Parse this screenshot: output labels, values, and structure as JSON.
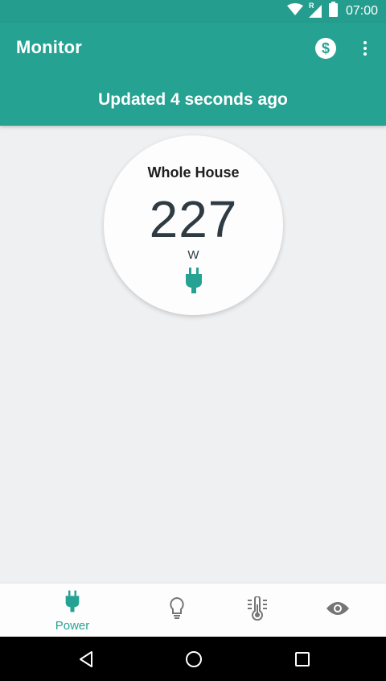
{
  "status_bar": {
    "time": "07:00",
    "roaming_indicator": "R",
    "icons": [
      "wifi-icon",
      "signal-icon",
      "battery-icon"
    ]
  },
  "app_bar": {
    "title": "Monitor",
    "updated_text": "Updated 4 seconds ago",
    "actions": {
      "currency_symbol": "$",
      "currency_icon": "dollar-icon",
      "overflow_icon": "more-vert-icon"
    }
  },
  "monitor_card": {
    "title": "Whole House",
    "value": "227",
    "unit": "W",
    "icon": "plug-icon"
  },
  "bottom_nav": {
    "items": [
      {
        "label": "Power",
        "icon": "plug-icon",
        "active": true
      },
      {
        "label": "",
        "icon": "lightbulb-icon",
        "active": false
      },
      {
        "label": "",
        "icon": "thermometer-icon",
        "active": false
      },
      {
        "label": "",
        "icon": "eye-icon",
        "active": false
      }
    ]
  },
  "system_nav": {
    "buttons": [
      "back-icon",
      "home-icon",
      "recents-icon"
    ]
  },
  "colors": {
    "primary": "#26a292",
    "status_bar": "#259d8e",
    "background": "#eff0f2",
    "value_text": "#2f3b42",
    "inactive_icon": "#757575"
  }
}
